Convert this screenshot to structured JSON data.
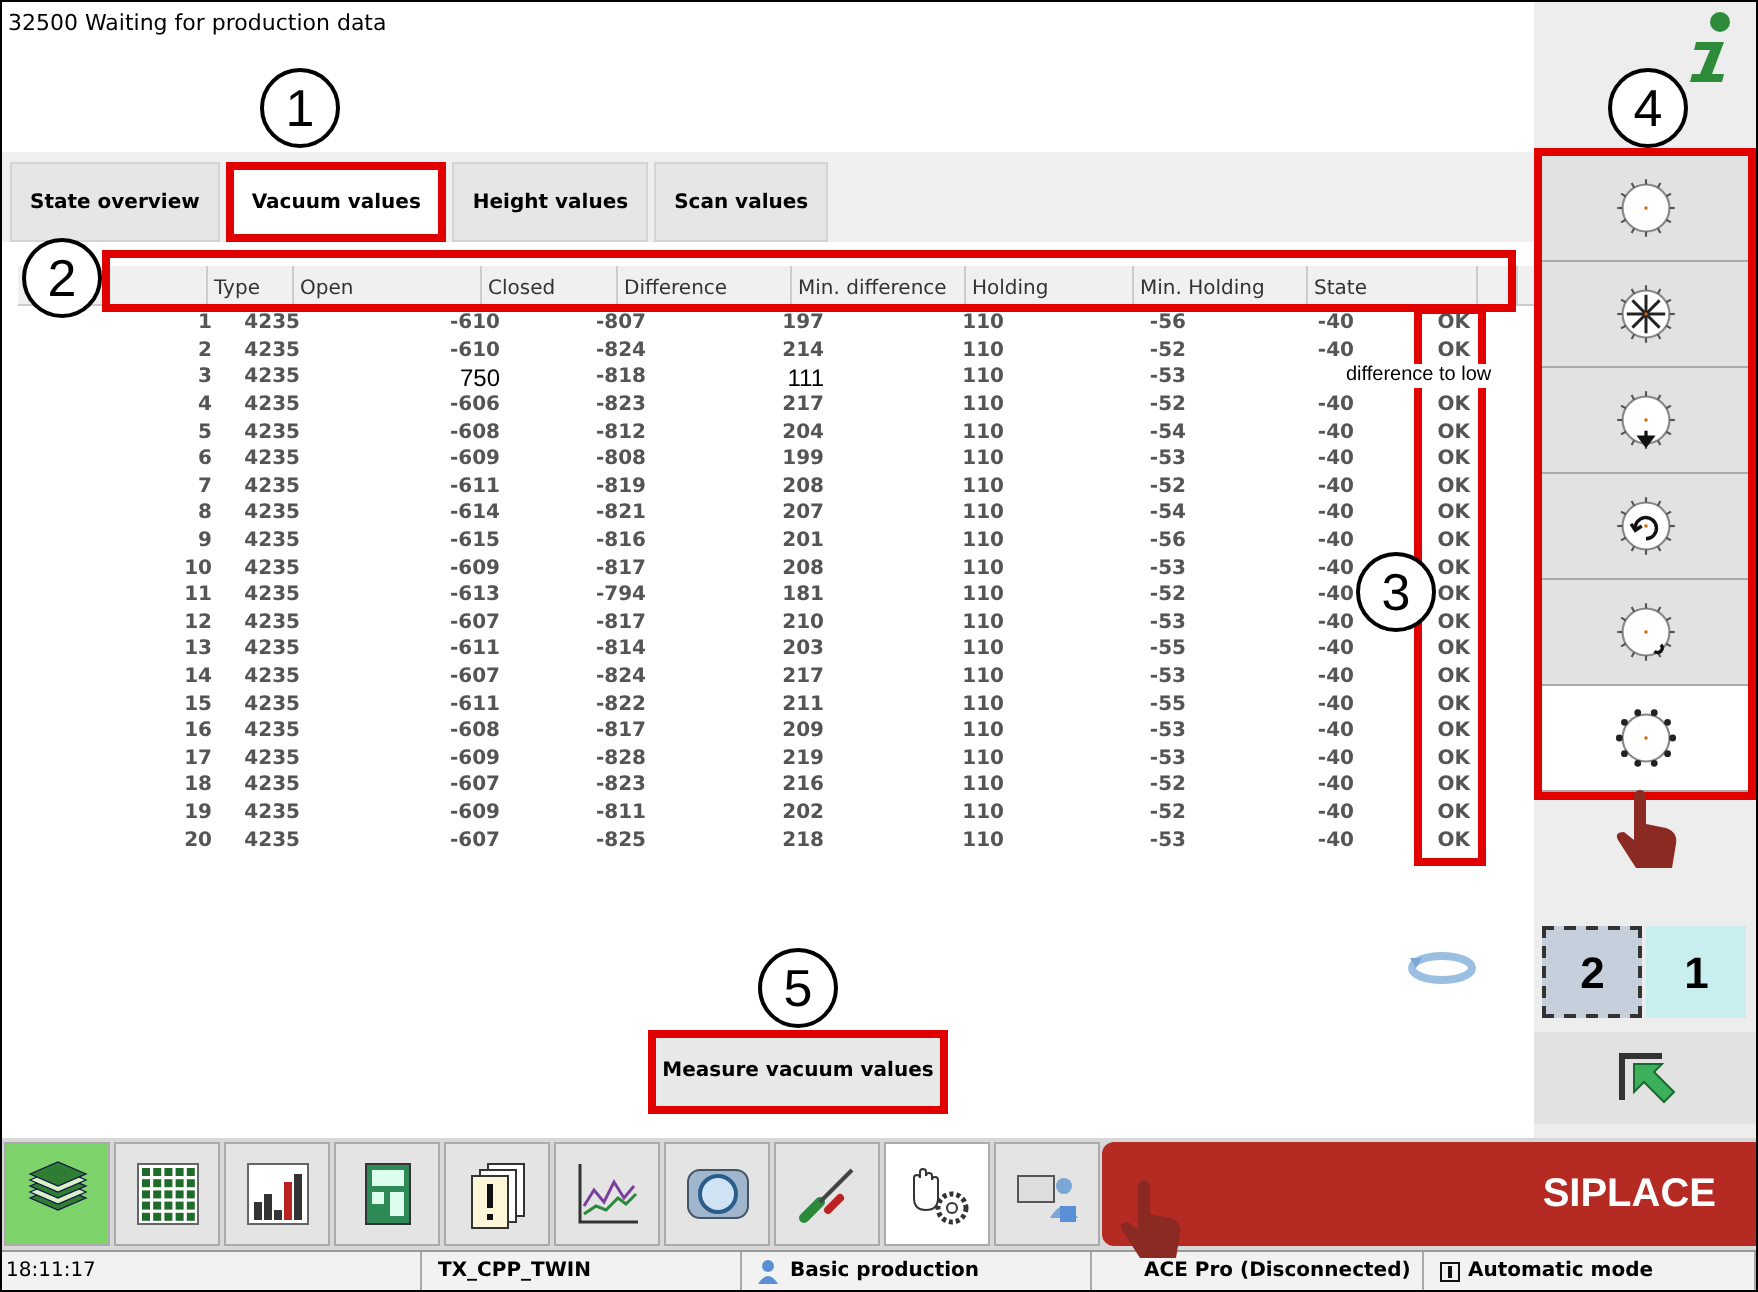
{
  "window": {
    "title": "32500 Waiting for production data"
  },
  "tabs": [
    {
      "label": "State overview",
      "selected": false
    },
    {
      "label": "Vacuum values",
      "selected": true
    },
    {
      "label": "Height values",
      "selected": false
    },
    {
      "label": "Scan values",
      "selected": false
    }
  ],
  "table": {
    "columns": [
      "Type",
      "Open",
      "Closed",
      "Difference",
      "Min. difference",
      "Holding",
      "Min. Holding",
      "State"
    ],
    "rows": [
      {
        "cells": [
          "1",
          "4235",
          "-610",
          "-807",
          "197",
          "110",
          "-56",
          "-40",
          "OK"
        ],
        "edited": false
      },
      {
        "cells": [
          "2",
          "4235",
          "-610",
          "-824",
          "214",
          "110",
          "-52",
          "-40",
          "OK"
        ],
        "edited": false
      },
      {
        "cells": [
          "3",
          "4235",
          "750",
          "-818",
          "111",
          "110",
          "-53",
          "",
          ""
        ],
        "edited": true,
        "note": "difference to low"
      },
      {
        "cells": [
          "4",
          "4235",
          "-606",
          "-823",
          "217",
          "110",
          "-52",
          "-40",
          "OK"
        ],
        "edited": false
      },
      {
        "cells": [
          "5",
          "4235",
          "-608",
          "-812",
          "204",
          "110",
          "-54",
          "-40",
          "OK"
        ],
        "edited": false
      },
      {
        "cells": [
          "6",
          "4235",
          "-609",
          "-808",
          "199",
          "110",
          "-53",
          "-40",
          "OK"
        ],
        "edited": false
      },
      {
        "cells": [
          "7",
          "4235",
          "-611",
          "-819",
          "208",
          "110",
          "-52",
          "-40",
          "OK"
        ],
        "edited": false
      },
      {
        "cells": [
          "8",
          "4235",
          "-614",
          "-821",
          "207",
          "110",
          "-54",
          "-40",
          "OK"
        ],
        "edited": false
      },
      {
        "cells": [
          "9",
          "4235",
          "-615",
          "-816",
          "201",
          "110",
          "-56",
          "-40",
          "OK"
        ],
        "edited": false
      },
      {
        "cells": [
          "10",
          "4235",
          "-609",
          "-817",
          "208",
          "110",
          "-53",
          "-40",
          "OK"
        ],
        "edited": false
      },
      {
        "cells": [
          "11",
          "4235",
          "-613",
          "-794",
          "181",
          "110",
          "-52",
          "-40",
          "OK"
        ],
        "edited": false
      },
      {
        "cells": [
          "12",
          "4235",
          "-607",
          "-817",
          "210",
          "110",
          "-53",
          "-40",
          "OK"
        ],
        "edited": false
      },
      {
        "cells": [
          "13",
          "4235",
          "-611",
          "-814",
          "203",
          "110",
          "-55",
          "-40",
          "OK"
        ],
        "edited": false
      },
      {
        "cells": [
          "14",
          "4235",
          "-607",
          "-824",
          "217",
          "110",
          "-53",
          "-40",
          "OK"
        ],
        "edited": false
      },
      {
        "cells": [
          "15",
          "4235",
          "-611",
          "-822",
          "211",
          "110",
          "-55",
          "-40",
          "OK"
        ],
        "edited": false
      },
      {
        "cells": [
          "16",
          "4235",
          "-608",
          "-817",
          "209",
          "110",
          "-53",
          "-40",
          "OK"
        ],
        "edited": false
      },
      {
        "cells": [
          "17",
          "4235",
          "-609",
          "-828",
          "219",
          "110",
          "-53",
          "-40",
          "OK"
        ],
        "edited": false
      },
      {
        "cells": [
          "18",
          "4235",
          "-607",
          "-823",
          "216",
          "110",
          "-52",
          "-40",
          "OK"
        ],
        "edited": false
      },
      {
        "cells": [
          "19",
          "4235",
          "-609",
          "-811",
          "202",
          "110",
          "-52",
          "-40",
          "OK"
        ],
        "edited": false
      },
      {
        "cells": [
          "20",
          "4235",
          "-607",
          "-825",
          "218",
          "110",
          "-53",
          "-40",
          "OK"
        ],
        "edited": false
      }
    ]
  },
  "measure_button": {
    "label": "Measure vacuum values"
  },
  "side_buttons": [
    {
      "selected": false
    },
    {
      "selected": false
    },
    {
      "selected": false
    },
    {
      "selected": false
    },
    {
      "selected": false
    },
    {
      "selected": true
    }
  ],
  "view_toggle": [
    {
      "label": "2",
      "selected": true
    },
    {
      "label": "1",
      "selected": false
    }
  ],
  "toolbar": [
    {
      "selected": false
    },
    {
      "selected": false
    },
    {
      "selected": false
    },
    {
      "selected": false
    },
    {
      "selected": false
    },
    {
      "selected": false
    },
    {
      "selected": false
    },
    {
      "selected": false
    },
    {
      "selected": true
    },
    {
      "selected": false
    }
  ],
  "brand": "SIPLACE",
  "status_bar": [
    "18:11:17",
    "TX_CPP_TWIN",
    "Basic production",
    "ACE Pro (Disconnected)",
    "Automatic mode"
  ],
  "callouts": [
    "1",
    "2",
    "3",
    "4",
    "5"
  ]
}
